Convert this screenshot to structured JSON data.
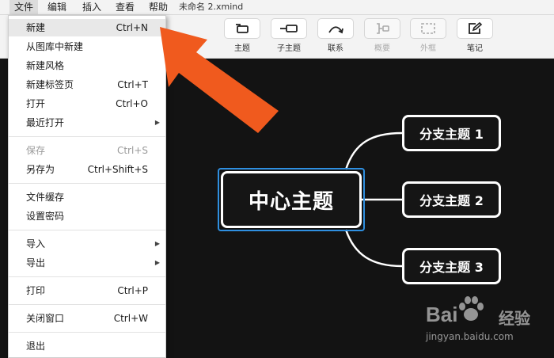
{
  "menubar": {
    "items": [
      "文件",
      "编辑",
      "插入",
      "查看",
      "帮助"
    ],
    "doc_title": "未命名 2.xmind"
  },
  "toolbar": {
    "buttons": [
      {
        "label": "主题",
        "icon": "topic-icon"
      },
      {
        "label": "子主题",
        "icon": "subtopic-icon"
      },
      {
        "label": "联系",
        "icon": "relationship-icon"
      },
      {
        "label": "概要",
        "icon": "summary-icon"
      },
      {
        "label": "外框",
        "icon": "boundary-icon"
      },
      {
        "label": "笔记",
        "icon": "note-icon"
      }
    ]
  },
  "file_menu": {
    "items": [
      {
        "label": "新建",
        "shortcut": "Ctrl+N"
      },
      {
        "label": "从图库中新建",
        "shortcut": ""
      },
      {
        "label": "新建风格",
        "shortcut": ""
      },
      {
        "label": "新建标签页",
        "shortcut": "Ctrl+T"
      },
      {
        "label": "打开",
        "shortcut": "Ctrl+O"
      },
      {
        "label": "最近打开",
        "shortcut": ""
      },
      {
        "label": "保存",
        "shortcut": "Ctrl+S"
      },
      {
        "label": "另存为",
        "shortcut": "Ctrl+Shift+S"
      },
      {
        "label": "文件缓存",
        "shortcut": ""
      },
      {
        "label": "设置密码",
        "shortcut": ""
      },
      {
        "label": "导入",
        "shortcut": ""
      },
      {
        "label": "导出",
        "shortcut": ""
      },
      {
        "label": "打印",
        "shortcut": "Ctrl+P"
      },
      {
        "label": "关闭窗口",
        "shortcut": "Ctrl+W"
      },
      {
        "label": "退出",
        "shortcut": ""
      }
    ]
  },
  "mindmap": {
    "central_topic": "中心主题",
    "branches": [
      "分支主题 1",
      "分支主题 2",
      "分支主题 3"
    ]
  },
  "watermark": {
    "brand": "Bai",
    "brand_cn": "经验",
    "url": "jingyan.baidu.com"
  },
  "colors": {
    "canvas": "#131313",
    "selection": "#2f8fe0",
    "arrow": "#f05a1e"
  }
}
